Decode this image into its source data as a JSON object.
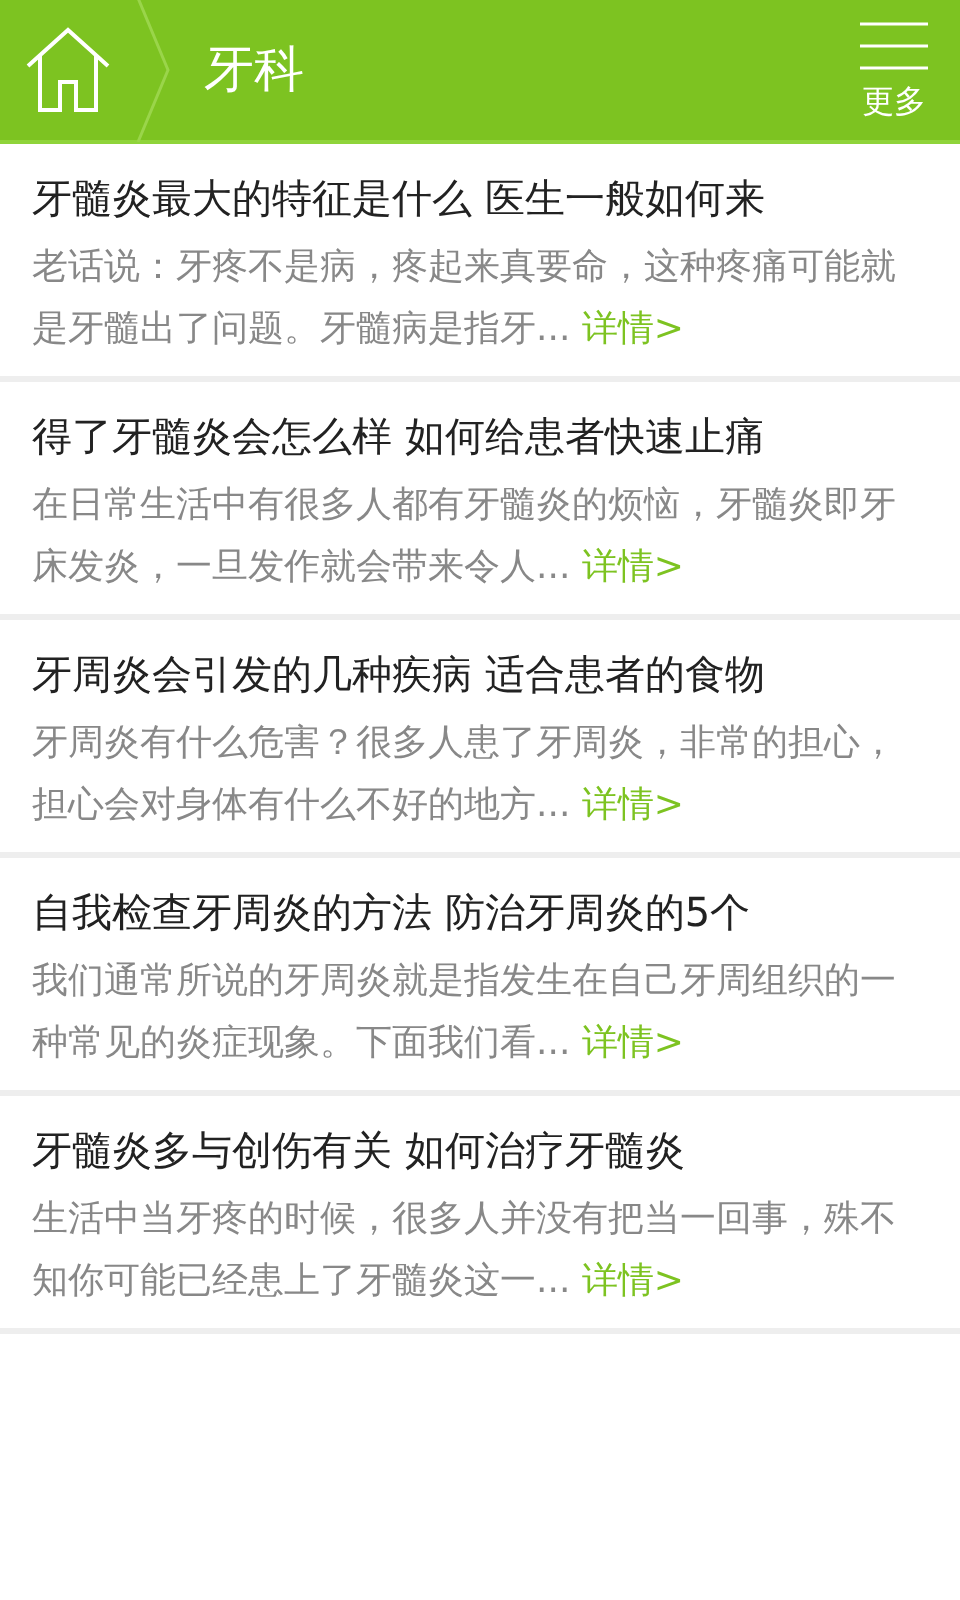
{
  "header": {
    "title": "牙科",
    "more": "更多"
  },
  "articles": [
    {
      "title": "牙髓炎最大的特征是什么 医生一般如何来",
      "summary": "老话说：牙疼不是病，疼起来真要命，这种疼痛可能就是牙髓出了问题。牙髓病是指牙...",
      "link": "详情>"
    },
    {
      "title": "得了牙髓炎会怎么样 如何给患者快速止痛",
      "summary": "在日常生活中有很多人都有牙髓炎的烦恼，牙髓炎即牙床发炎，一旦发作就会带来令人...",
      "link": "详情>"
    },
    {
      "title": "牙周炎会引发的几种疾病 适合患者的食物",
      "summary": "牙周炎有什么危害？很多人患了牙周炎，非常的担心，担心会对身体有什么不好的地方...",
      "link": "详情>"
    },
    {
      "title": "自我检查牙周炎的方法 防治牙周炎的5个",
      "summary": "我们通常所说的牙周炎就是指发生在自己牙周组织的一种常见的炎症现象。下面我们看...",
      "link": "详情>"
    },
    {
      "title": "牙髓炎多与创伤有关 如何治疗牙髓炎",
      "summary": "生活中当牙疼的时候，很多人并没有把当一回事，殊不知你可能已经患上了牙髓炎这一...",
      "link": "详情>"
    }
  ]
}
